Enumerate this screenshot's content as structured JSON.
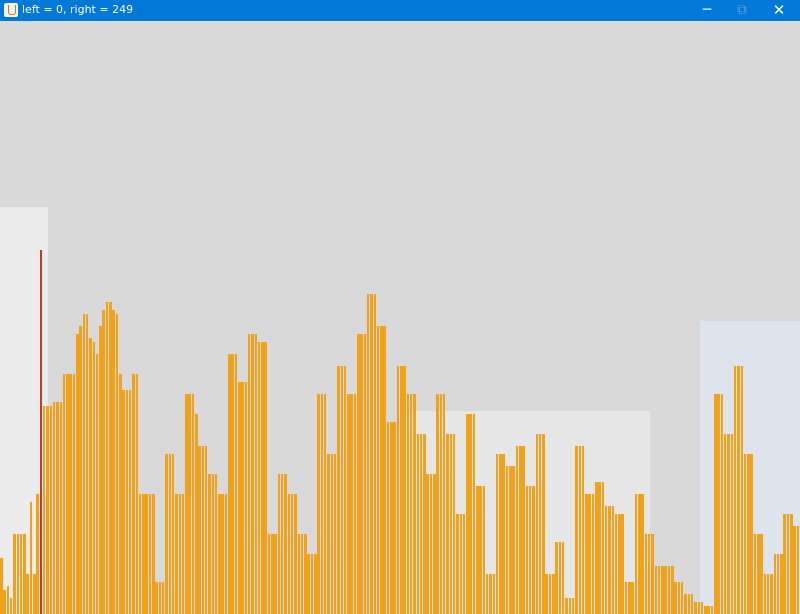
{
  "window": {
    "title": "left = 0, right = 249",
    "controls": {
      "minimize": "─",
      "maximize": "⧉",
      "close": "✕"
    },
    "icon": "java-cup-icon"
  },
  "chart_data": {
    "type": "bar",
    "colors": {
      "bar": "#f2a11b",
      "highlight": "#c0392b",
      "background": "#d9d9d9",
      "gap": "#ffffff"
    },
    "ylim": [
      0,
      1
    ],
    "highlight_index": 12,
    "values": [
      0.14,
      0.06,
      0.07,
      0.04,
      0.2,
      0.2,
      0.2,
      0.2,
      0.1,
      0.28,
      0.1,
      0.3,
      0.91,
      0.52,
      0.52,
      0.52,
      0.53,
      0.53,
      0.53,
      0.6,
      0.6,
      0.6,
      0.6,
      0.7,
      0.72,
      0.75,
      0.75,
      0.69,
      0.68,
      0.65,
      0.72,
      0.76,
      0.78,
      0.78,
      0.76,
      0.75,
      0.6,
      0.56,
      0.56,
      0.56,
      0.6,
      0.6,
      0.3,
      0.3,
      0.3,
      0.3,
      0.3,
      0.08,
      0.08,
      0.08,
      0.4,
      0.4,
      0.4,
      0.3,
      0.3,
      0.3,
      0.55,
      0.55,
      0.55,
      0.5,
      0.42,
      0.42,
      0.42,
      0.35,
      0.35,
      0.35,
      0.3,
      0.3,
      0.3,
      0.65,
      0.65,
      0.65,
      0.58,
      0.58,
      0.58,
      0.7,
      0.7,
      0.7,
      0.68,
      0.68,
      0.68,
      0.2,
      0.2,
      0.2,
      0.35,
      0.35,
      0.35,
      0.3,
      0.3,
      0.3,
      0.2,
      0.2,
      0.2,
      0.15,
      0.15,
      0.15,
      0.55,
      0.55,
      0.55,
      0.4,
      0.4,
      0.4,
      0.62,
      0.62,
      0.62,
      0.55,
      0.55,
      0.55,
      0.7,
      0.7,
      0.7,
      0.8,
      0.8,
      0.8,
      0.72,
      0.72,
      0.72,
      0.48,
      0.48,
      0.48,
      0.62,
      0.62,
      0.62,
      0.55,
      0.55,
      0.55,
      0.45,
      0.45,
      0.45,
      0.35,
      0.35,
      0.35,
      0.55,
      0.55,
      0.55,
      0.45,
      0.45,
      0.45,
      0.25,
      0.25,
      0.25,
      0.5,
      0.5,
      0.5,
      0.32,
      0.32,
      0.32,
      0.1,
      0.1,
      0.1,
      0.4,
      0.4,
      0.4,
      0.37,
      0.37,
      0.37,
      0.42,
      0.42,
      0.42,
      0.32,
      0.32,
      0.32,
      0.45,
      0.45,
      0.45,
      0.1,
      0.1,
      0.1,
      0.18,
      0.18,
      0.18,
      0.04,
      0.04,
      0.04,
      0.42,
      0.42,
      0.42,
      0.3,
      0.3,
      0.3,
      0.33,
      0.33,
      0.33,
      0.27,
      0.27,
      0.27,
      0.25,
      0.25,
      0.25,
      0.08,
      0.08,
      0.08,
      0.3,
      0.3,
      0.3,
      0.2,
      0.2,
      0.2,
      0.12,
      0.12,
      0.12,
      0.12,
      0.12,
      0.12,
      0.08,
      0.08,
      0.08,
      0.05,
      0.05,
      0.05,
      0.03,
      0.03,
      0.03,
      0.02,
      0.02,
      0.02,
      0.55,
      0.55,
      0.55,
      0.45,
      0.45,
      0.45,
      0.62,
      0.62,
      0.62,
      0.4,
      0.4,
      0.4,
      0.2,
      0.2,
      0.2,
      0.1,
      0.1,
      0.1,
      0.15,
      0.15,
      0.15,
      0.25,
      0.25,
      0.25,
      0.22,
      0.22
    ]
  }
}
